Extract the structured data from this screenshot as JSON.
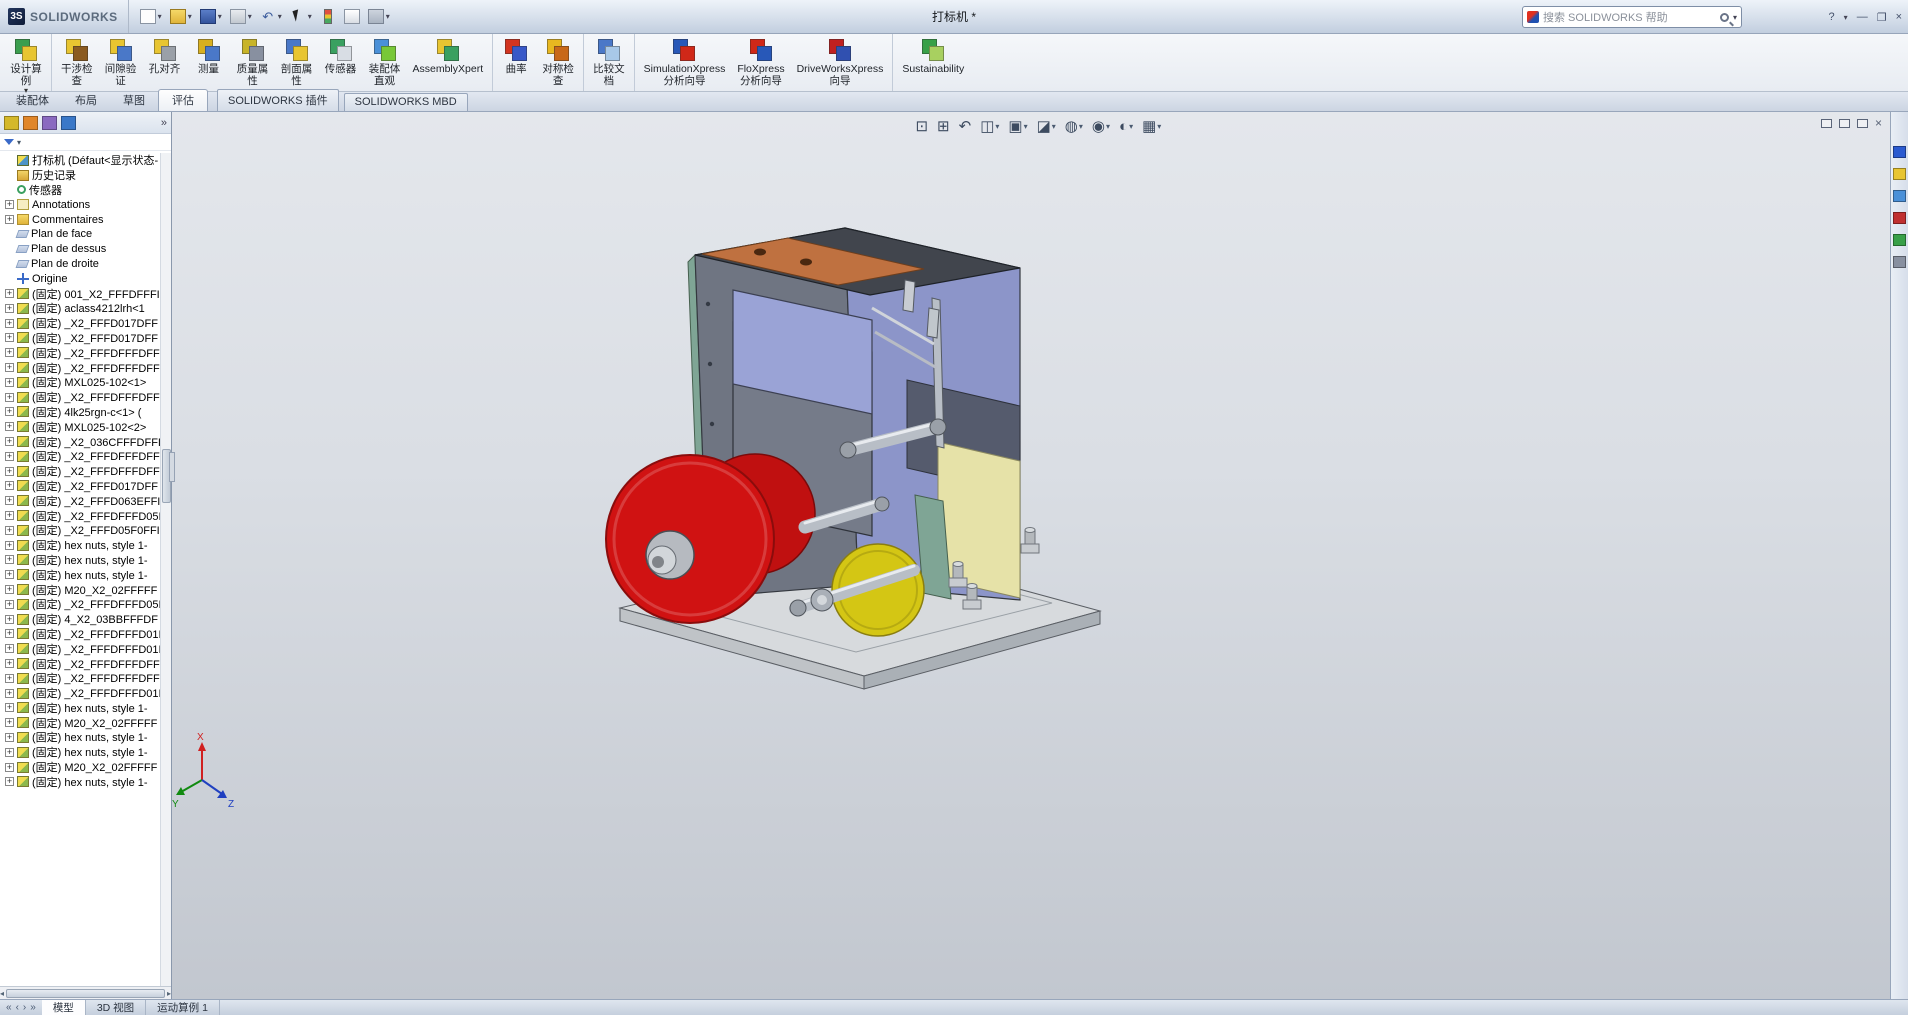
{
  "titlebar": {
    "brand_mark": "3S",
    "brand_name": "SOLIDWORKS",
    "document_title": "打标机 *",
    "search_placeholder": "搜索 SOLIDWORKS 帮助",
    "help_glyph": "?",
    "help_caret": "▾",
    "quick_tools": [
      {
        "name": "new-document-button",
        "cls": "new",
        "glyph": "",
        "dd": true
      },
      {
        "name": "open-button",
        "cls": "open",
        "glyph": "",
        "dd": true
      },
      {
        "name": "save-button",
        "cls": "save",
        "glyph": "",
        "dd": true
      },
      {
        "name": "print-button",
        "cls": "print",
        "glyph": "",
        "dd": true
      },
      {
        "name": "undo-button",
        "cls": "glyph",
        "glyph": "↶",
        "dd": true
      },
      {
        "name": "select-button",
        "cls": "select",
        "glyph": "",
        "dd": true
      },
      {
        "name": "rebuild-button",
        "cls": "rebuild",
        "glyph": "",
        "dd": false
      },
      {
        "name": "file-properties-button",
        "cls": "props",
        "glyph": "",
        "dd": false
      },
      {
        "name": "options-button",
        "cls": "options",
        "glyph": "",
        "dd": true
      }
    ],
    "window_controls": [
      "—",
      "❐",
      "×"
    ]
  },
  "ribbon": {
    "buttons": [
      {
        "line1": "设计算",
        "line2": "例",
        "caret": "▾",
        "name": "design-study-button",
        "dd": true,
        "sep": "",
        "c1": "#3a9e4e",
        "c2": "#e8c531"
      },
      {
        "line1": "干涉检",
        "line2": "查",
        "caret": "",
        "name": "interference-detection-button",
        "dd": false,
        "sep": "sep",
        "c1": "#e8c531",
        "c2": "#8a5a20"
      },
      {
        "line1": "间隙验",
        "line2": "证",
        "caret": "",
        "name": "clearance-verification-button",
        "dd": false,
        "sep": "",
        "c1": "#e8c531",
        "c2": "#4a78c8"
      },
      {
        "line1": "孔对齐",
        "line2": "",
        "caret": "",
        "name": "hole-alignment-button",
        "dd": false,
        "sep": "",
        "c1": "#e8c531",
        "c2": "#9aa0a8"
      },
      {
        "line1": "测量",
        "line2": "",
        "caret": "",
        "name": "measure-button",
        "dd": false,
        "sep": "",
        "c1": "#d8b020",
        "c2": "#4a78c8"
      },
      {
        "line1": "质量属",
        "line2": "性",
        "caret": "",
        "name": "mass-properties-button",
        "dd": false,
        "sep": "",
        "c1": "#c8b428",
        "c2": "#8890a0"
      },
      {
        "line1": "剖面属",
        "line2": "性",
        "caret": "",
        "name": "section-properties-button",
        "dd": false,
        "sep": "",
        "c1": "#4a78c8",
        "c2": "#e8c531"
      },
      {
        "line1": "传感器",
        "line2": "",
        "caret": "",
        "name": "sensor-button",
        "dd": false,
        "sep": "",
        "c1": "#3aa060",
        "c2": "#d8dde4"
      },
      {
        "line1": "装配体",
        "line2": "直观",
        "caret": "",
        "name": "assembly-visualization-button",
        "dd": false,
        "sep": "",
        "c1": "#4a90d8",
        "c2": "#78c838"
      },
      {
        "line1": "AssemblyXpert",
        "line2": "",
        "caret": "",
        "name": "assemblyxpert-button",
        "dd": false,
        "sep": "",
        "c1": "#e8c531",
        "c2": "#3aa060"
      },
      {
        "line1": "曲率",
        "line2": "",
        "caret": "",
        "name": "curvature-button",
        "dd": false,
        "sep": "sep",
        "c1": "#d23420",
        "c2": "#3858c8"
      },
      {
        "line1": "对称检",
        "line2": "查",
        "caret": "",
        "name": "symmetry-check-button",
        "dd": false,
        "sep": "",
        "c1": "#e8b820",
        "c2": "#c86818"
      },
      {
        "line1": "比较文",
        "line2": "档",
        "caret": "",
        "name": "compare-documents-button",
        "dd": false,
        "sep": "sep",
        "c1": "#4a78c8",
        "c2": "#a8c8e8"
      },
      {
        "line1": "SimulationXpress",
        "line2": "分析向导",
        "caret": "",
        "name": "simulationxpress-wizard-button",
        "dd": false,
        "sep": "sep",
        "c1": "#2858b8",
        "c2": "#d02818"
      },
      {
        "line1": "FloXpress",
        "line2": "分析向导",
        "caret": "",
        "name": "floxpress-wizard-button",
        "dd": false,
        "sep": "",
        "c1": "#d02818",
        "c2": "#2858b8"
      },
      {
        "line1": "DriveWorksXpress",
        "line2": "向导",
        "caret": "",
        "name": "driveworksxpress-wizard-button",
        "dd": false,
        "sep": "",
        "c1": "#c02020",
        "c2": "#3050b0"
      },
      {
        "line1": "Sustainability",
        "line2": "",
        "caret": "",
        "name": "sustainability-button",
        "dd": false,
        "sep": "sep",
        "c1": "#38a048",
        "c2": "#a8d060"
      }
    ]
  },
  "command_tabs": {
    "tabs": [
      {
        "label": "装配体",
        "state": ""
      },
      {
        "label": "布局",
        "state": ""
      },
      {
        "label": "草图",
        "state": ""
      },
      {
        "label": "评估",
        "state": "active"
      }
    ],
    "addin_tabs": [
      {
        "label": "SOLIDWORKS 插件"
      },
      {
        "label": "SOLIDWORKS MBD"
      }
    ]
  },
  "left_panel": {
    "header_icons": [
      {
        "name": "featuremanager-tree-icon",
        "color": "#d4b82a"
      },
      {
        "name": "propertymanager-icon",
        "color": "#e0862a"
      },
      {
        "name": "configurationmanager-icon",
        "color": "#8a6ac0"
      },
      {
        "name": "dimxpertmanager-icon",
        "color": "#3a78c8"
      }
    ],
    "expand_chevrons": "»",
    "root_caret": "▴",
    "scroll_up": "▲",
    "scroll_down": "▼",
    "hscroll_left": "◂",
    "hscroll_right": "▸"
  },
  "feature_tree": {
    "root_label": "打标机  (Défaut<显示状态-",
    "items": [
      {
        "label": "历史记录",
        "icon": "history-folder-icon",
        "cls": "ico-history",
        "plus": "",
        "exp": "no"
      },
      {
        "label": "传感器",
        "icon": "sensors-icon",
        "cls": "ico-sensor",
        "plus": "",
        "exp": "no"
      },
      {
        "label": "Annotations",
        "icon": "annotations-folder-icon",
        "cls": "ico-ann",
        "plus": "+",
        "exp": "yes"
      },
      {
        "label": "Commentaires",
        "icon": "comments-folder-icon",
        "cls": "ico-comm",
        "plus": "+",
        "exp": "yes"
      },
      {
        "label": "Plan de face",
        "icon": "plane-icon",
        "cls": "ico-plane",
        "plus": "",
        "exp": "no"
      },
      {
        "label": "Plan de dessus",
        "icon": "plane-icon",
        "cls": "ico-plane",
        "plus": "",
        "exp": "no"
      },
      {
        "label": "Plan de droite",
        "icon": "plane-icon",
        "cls": "ico-plane",
        "plus": "",
        "exp": "no"
      },
      {
        "label": "Origine",
        "icon": "origin-icon",
        "cls": "ico-origin",
        "plus": "",
        "exp": "no"
      },
      {
        "label": "(固定) 001_X2_FFFDFFFI",
        "icon": "part-icon",
        "cls": "ico-part",
        "plus": "+",
        "exp": "yes"
      },
      {
        "label": "(固定) aclass4212lrh<1",
        "icon": "part-icon",
        "cls": "ico-part",
        "plus": "+",
        "exp": "yes"
      },
      {
        "label": "(固定) _X2_FFFD017DFF",
        "icon": "part-icon",
        "cls": "ico-part",
        "plus": "+",
        "exp": "yes"
      },
      {
        "label": "(固定) _X2_FFFD017DFF",
        "icon": "part-icon",
        "cls": "ico-part",
        "plus": "+",
        "exp": "yes"
      },
      {
        "label": "(固定) _X2_FFFDFFFDFFI",
        "icon": "part-icon",
        "cls": "ico-part",
        "plus": "+",
        "exp": "yes"
      },
      {
        "label": "(固定) _X2_FFFDFFFDFFI",
        "icon": "part-icon",
        "cls": "ico-part",
        "plus": "+",
        "exp": "yes"
      },
      {
        "label": "(固定) MXL025-102<1>",
        "icon": "part-icon",
        "cls": "ico-part",
        "plus": "+",
        "exp": "yes"
      },
      {
        "label": "(固定) _X2_FFFDFFFDFFI",
        "icon": "part-icon",
        "cls": "ico-part",
        "plus": "+",
        "exp": "yes"
      },
      {
        "label": "(固定) 4lk25rgn-c<1> (",
        "icon": "part-icon",
        "cls": "ico-part",
        "plus": "+",
        "exp": "yes"
      },
      {
        "label": "(固定) MXL025-102<2>",
        "icon": "part-icon",
        "cls": "ico-part",
        "plus": "+",
        "exp": "yes"
      },
      {
        "label": "(固定) _X2_036CFFFDFFI",
        "icon": "part-icon",
        "cls": "ico-part",
        "plus": "+",
        "exp": "yes"
      },
      {
        "label": "(固定) _X2_FFFDFFFDFFI",
        "icon": "part-icon",
        "cls": "ico-part",
        "plus": "+",
        "exp": "yes"
      },
      {
        "label": "(固定) _X2_FFFDFFFDFFI",
        "icon": "part-icon",
        "cls": "ico-part",
        "plus": "+",
        "exp": "yes"
      },
      {
        "label": "(固定) _X2_FFFD017DFF",
        "icon": "part-icon",
        "cls": "ico-part",
        "plus": "+",
        "exp": "yes"
      },
      {
        "label": "(固定) _X2_FFFD063EFFI",
        "icon": "part-icon",
        "cls": "ico-part",
        "plus": "+",
        "exp": "yes"
      },
      {
        "label": "(固定) _X2_FFFDFFFD05I",
        "icon": "part-icon",
        "cls": "ico-part",
        "plus": "+",
        "exp": "yes"
      },
      {
        "label": "(固定) _X2_FFFD05F0FFI",
        "icon": "part-icon",
        "cls": "ico-part",
        "plus": "+",
        "exp": "yes"
      },
      {
        "label": "(固定) hex nuts, style 1-",
        "icon": "part-icon",
        "cls": "ico-part",
        "plus": "+",
        "exp": "yes"
      },
      {
        "label": "(固定) hex nuts, style 1-",
        "icon": "part-icon",
        "cls": "ico-part",
        "plus": "+",
        "exp": "yes"
      },
      {
        "label": "(固定) hex nuts, style 1-",
        "icon": "part-icon",
        "cls": "ico-part",
        "plus": "+",
        "exp": "yes"
      },
      {
        "label": "(固定) M20_X2_02FFFFF",
        "icon": "part-icon",
        "cls": "ico-part",
        "plus": "+",
        "exp": "yes"
      },
      {
        "label": "(固定) _X2_FFFDFFFD05I",
        "icon": "part-icon",
        "cls": "ico-part",
        "plus": "+",
        "exp": "yes"
      },
      {
        "label": "(固定) 4_X2_03BBFFFDF",
        "icon": "part-icon",
        "cls": "ico-part",
        "plus": "+",
        "exp": "yes"
      },
      {
        "label": "(固定) _X2_FFFDFFFD01I",
        "icon": "part-icon",
        "cls": "ico-part",
        "plus": "+",
        "exp": "yes"
      },
      {
        "label": "(固定) _X2_FFFDFFFD01I",
        "icon": "part-icon",
        "cls": "ico-part",
        "plus": "+",
        "exp": "yes"
      },
      {
        "label": "(固定) _X2_FFFDFFFDFF",
        "icon": "part-icon",
        "cls": "ico-part",
        "plus": "+",
        "exp": "yes"
      },
      {
        "label": "(固定) _X2_FFFDFFFDFFI",
        "icon": "part-icon",
        "cls": "ico-part",
        "plus": "+",
        "exp": "yes"
      },
      {
        "label": "(固定) _X2_FFFDFFFD01I",
        "icon": "part-icon",
        "cls": "ico-part",
        "plus": "+",
        "exp": "yes"
      },
      {
        "label": "(固定) hex nuts, style 1-",
        "icon": "part-icon",
        "cls": "ico-part",
        "plus": "+",
        "exp": "yes"
      },
      {
        "label": "(固定) M20_X2_02FFFFF",
        "icon": "part-icon",
        "cls": "ico-part",
        "plus": "+",
        "exp": "yes"
      },
      {
        "label": "(固定) hex nuts, style 1-",
        "icon": "part-icon",
        "cls": "ico-part",
        "plus": "+",
        "exp": "yes"
      },
      {
        "label": "(固定) hex nuts, style 1-",
        "icon": "part-icon",
        "cls": "ico-part",
        "plus": "+",
        "exp": "yes"
      },
      {
        "label": "(固定) M20_X2_02FFFFF",
        "icon": "part-icon",
        "cls": "ico-part",
        "plus": "+",
        "exp": "yes"
      },
      {
        "label": "(固定) hex nuts, style 1-",
        "icon": "part-icon",
        "cls": "ico-part",
        "plus": "+",
        "exp": "yes"
      }
    ]
  },
  "viewport": {
    "heads_up_tools": [
      {
        "name": "zoom-to-fit-icon",
        "glyph": "⊡",
        "dd": false
      },
      {
        "name": "zoom-to-area-icon",
        "glyph": "⊞",
        "dd": false
      },
      {
        "name": "previous-view-icon",
        "glyph": "↶",
        "dd": false
      },
      {
        "name": "section-view-icon",
        "glyph": "◫",
        "dd": true
      },
      {
        "name": "view-orientation-icon",
        "glyph": "▣",
        "dd": true
      },
      {
        "name": "display-style-icon",
        "glyph": "◪",
        "dd": true
      },
      {
        "name": "hide-show-items-icon",
        "glyph": "◍",
        "dd": true
      },
      {
        "name": "edit-appearance-icon",
        "glyph": "◉",
        "dd": true
      },
      {
        "name": "apply-scene-icon",
        "glyph": "◐",
        "dd": true
      },
      {
        "name": "view-settings-icon",
        "glyph": "▦",
        "dd": true
      }
    ],
    "window_icons": [
      "box",
      "box",
      "box"
    ],
    "close_glyph": "×",
    "triad": {
      "x": "X",
      "y": "Y",
      "z": "Z"
    }
  },
  "right_taskpane": {
    "icons": [
      {
        "name": "solidworks-resources-icon",
        "color": "#2a5ad0"
      },
      {
        "name": "design-library-icon",
        "color": "#e8c531"
      },
      {
        "name": "file-explorer-icon",
        "color": "#4a90d8"
      },
      {
        "name": "view-palette-icon",
        "color": "#c03030"
      },
      {
        "name": "appearances-scenes-icon",
        "color": "#38a048"
      },
      {
        "name": "custom-properties-icon",
        "color": "#8890a0"
      }
    ]
  },
  "statusbar": {
    "nav_glyphs": [
      "«",
      "‹",
      "›",
      "»"
    ],
    "tabs": [
      {
        "label": "模型",
        "state": "active"
      },
      {
        "label": "3D 视图",
        "state": ""
      },
      {
        "label": "运动算例 1",
        "state": ""
      }
    ]
  },
  "model_colors": {
    "base_plate": "#d7dadd",
    "base_side": "#bfc3c7",
    "base_side2": "#aab0b6",
    "slate_body": "#6f7582",
    "lavender_panel": "#8c95c9",
    "dark_panel": "#555b6d",
    "cream_panel": "#e6e2a8",
    "teal_panel": "#7fa595",
    "top_face": "#41454d",
    "copper_plate": "#bf7140",
    "hopper_front": "#757b89",
    "hopper_wall": "#9aa3d6",
    "red_reel": "#d01212",
    "red_reel2": "#c01010",
    "yellow_disc": "#d4c614",
    "roller": "#b8bec6",
    "triad_x": "#d02020",
    "triad_y": "#108a10",
    "triad_z": "#2040c0"
  }
}
